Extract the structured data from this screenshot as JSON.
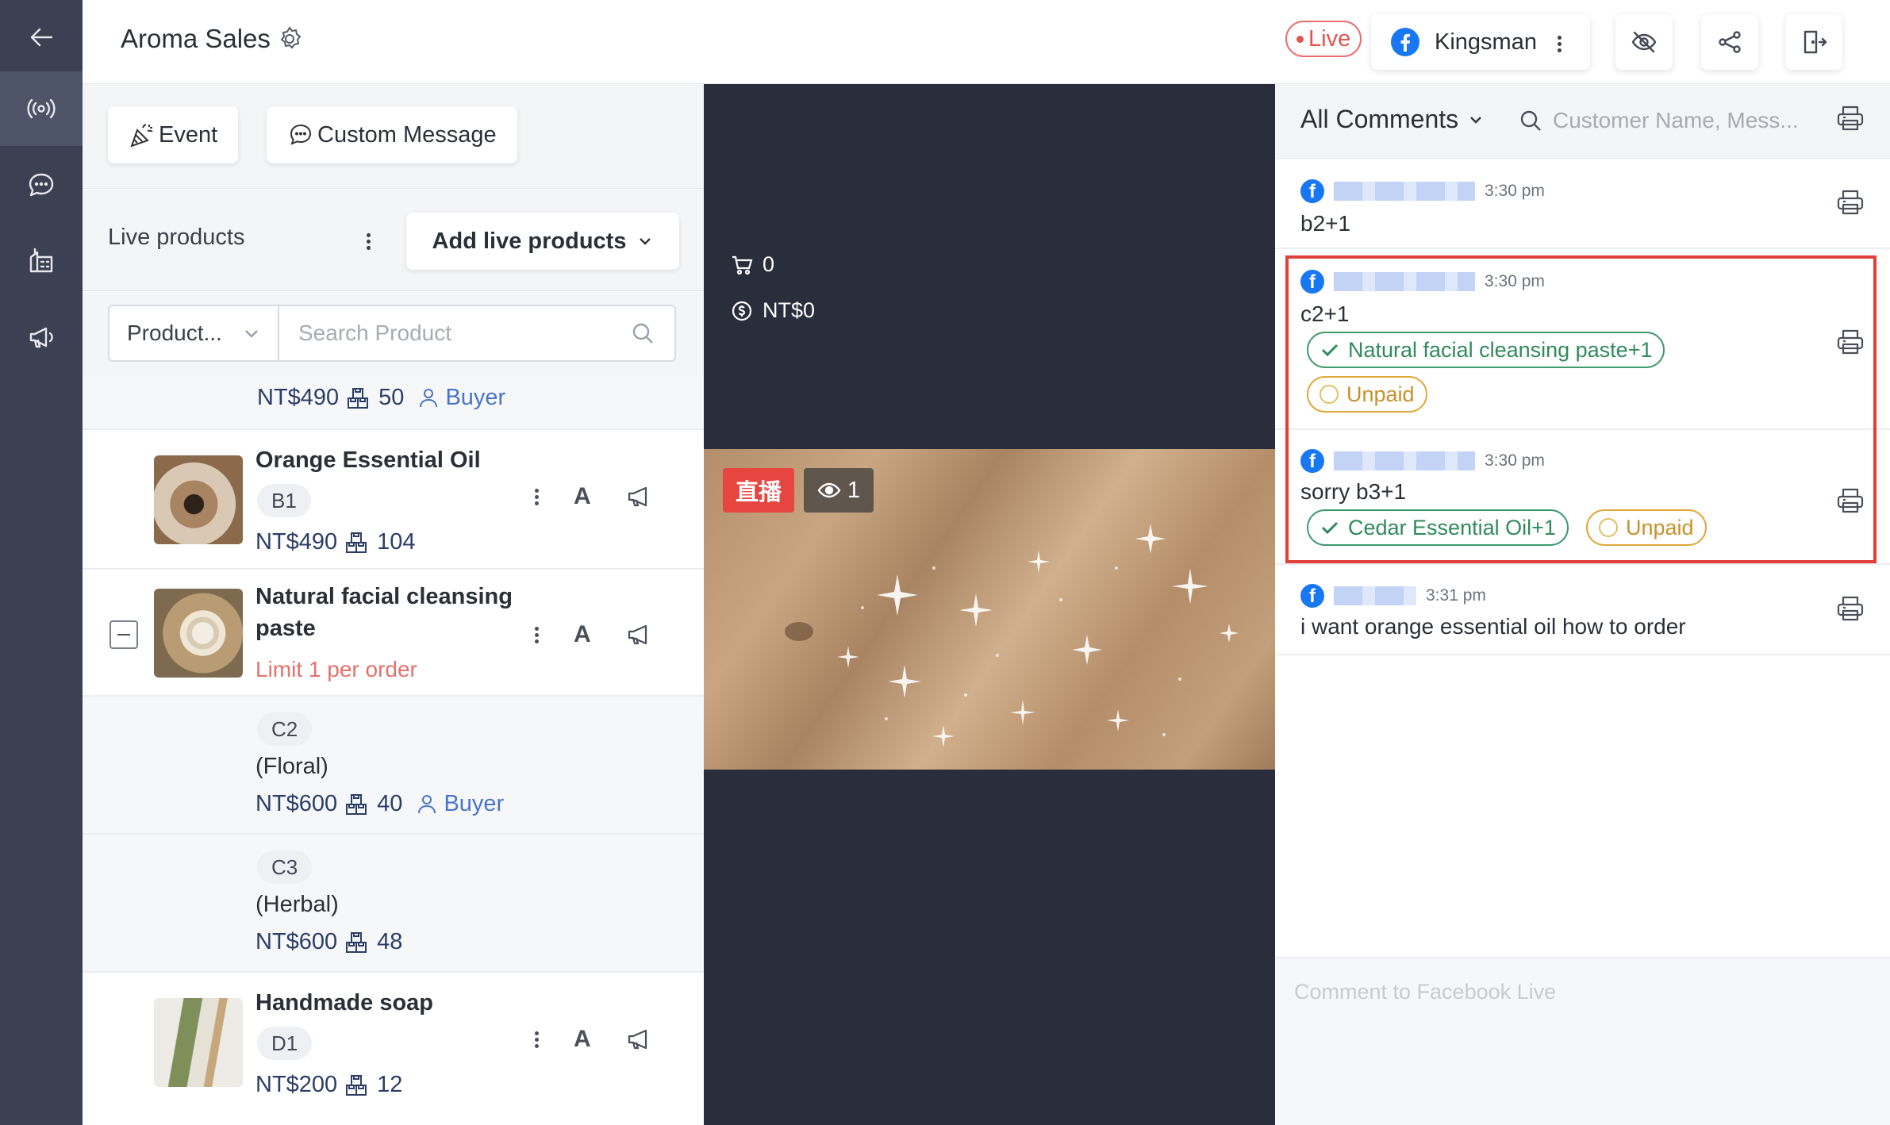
{
  "header": {
    "title": "Aroma Sales",
    "live_label": "Live",
    "account_name": "Kingsman"
  },
  "left": {
    "event_label": "Event",
    "custom_message_label": "Custom Message",
    "live_products_label": "Live products",
    "add_live_products_label": "Add live products",
    "filter_select": "Product...",
    "search_placeholder": "Search Product",
    "products": [
      {
        "price": "NT$490",
        "stock": "50",
        "buyer": "Buyer"
      },
      {
        "name": "Orange Essential Oil",
        "code": "B1",
        "price": "NT$490",
        "stock": "104"
      },
      {
        "name_line1": "Natural facial cleansing",
        "name_line2": "paste",
        "limit": "Limit 1 per order"
      },
      {
        "code": "C2",
        "variant": "(Floral)",
        "price": "NT$600",
        "stock": "40",
        "buyer": "Buyer"
      },
      {
        "code": "C3",
        "variant": "(Herbal)",
        "price": "NT$600",
        "stock": "48"
      },
      {
        "name": "Handmade soap",
        "code": "D1",
        "price": "NT$200",
        "stock": "12"
      }
    ],
    "action_letter": "A"
  },
  "video": {
    "cart_count": "0",
    "revenue": "NT$0",
    "live_badge": "直播",
    "viewers": "1"
  },
  "right": {
    "filter_label": "All Comments",
    "search_placeholder": "Customer Name, Mess...",
    "comments": [
      {
        "time": "3:30 pm",
        "text": "b2+1"
      },
      {
        "time": "3:30 pm",
        "text": "c2+1",
        "tag_product": "Natural facial cleansing paste+1",
        "tag_status": "Unpaid"
      },
      {
        "time": "3:30 pm",
        "text": "sorry b3+1",
        "tag_product": "Cedar Essential Oil+1",
        "tag_status": "Unpaid"
      },
      {
        "time": "3:31 pm",
        "text": "i want orange essential oil how to order"
      }
    ],
    "comment_placeholder": "Comment to Facebook Live"
  },
  "colors": {
    "sidebar": "#3b4152",
    "live_red": "#e2554f",
    "highlight": "#e0403a",
    "paid_green": "#2f8a5c",
    "unpaid_gold": "#c9902a",
    "link_blue": "#4a74c8"
  },
  "icons": [
    "back-arrow-icon",
    "live-broadcast-icon",
    "chat-icon",
    "store-icon",
    "megaphone-icon",
    "gear-icon",
    "facebook-icon",
    "eye-off-icon",
    "share-icon",
    "exit-icon",
    "party-popper-icon",
    "message-icon",
    "chevron-down-icon",
    "search-icon",
    "boxes-icon",
    "user-icon",
    "printer-icon",
    "cart-icon",
    "dollar-icon",
    "eye-icon",
    "check-icon"
  ]
}
